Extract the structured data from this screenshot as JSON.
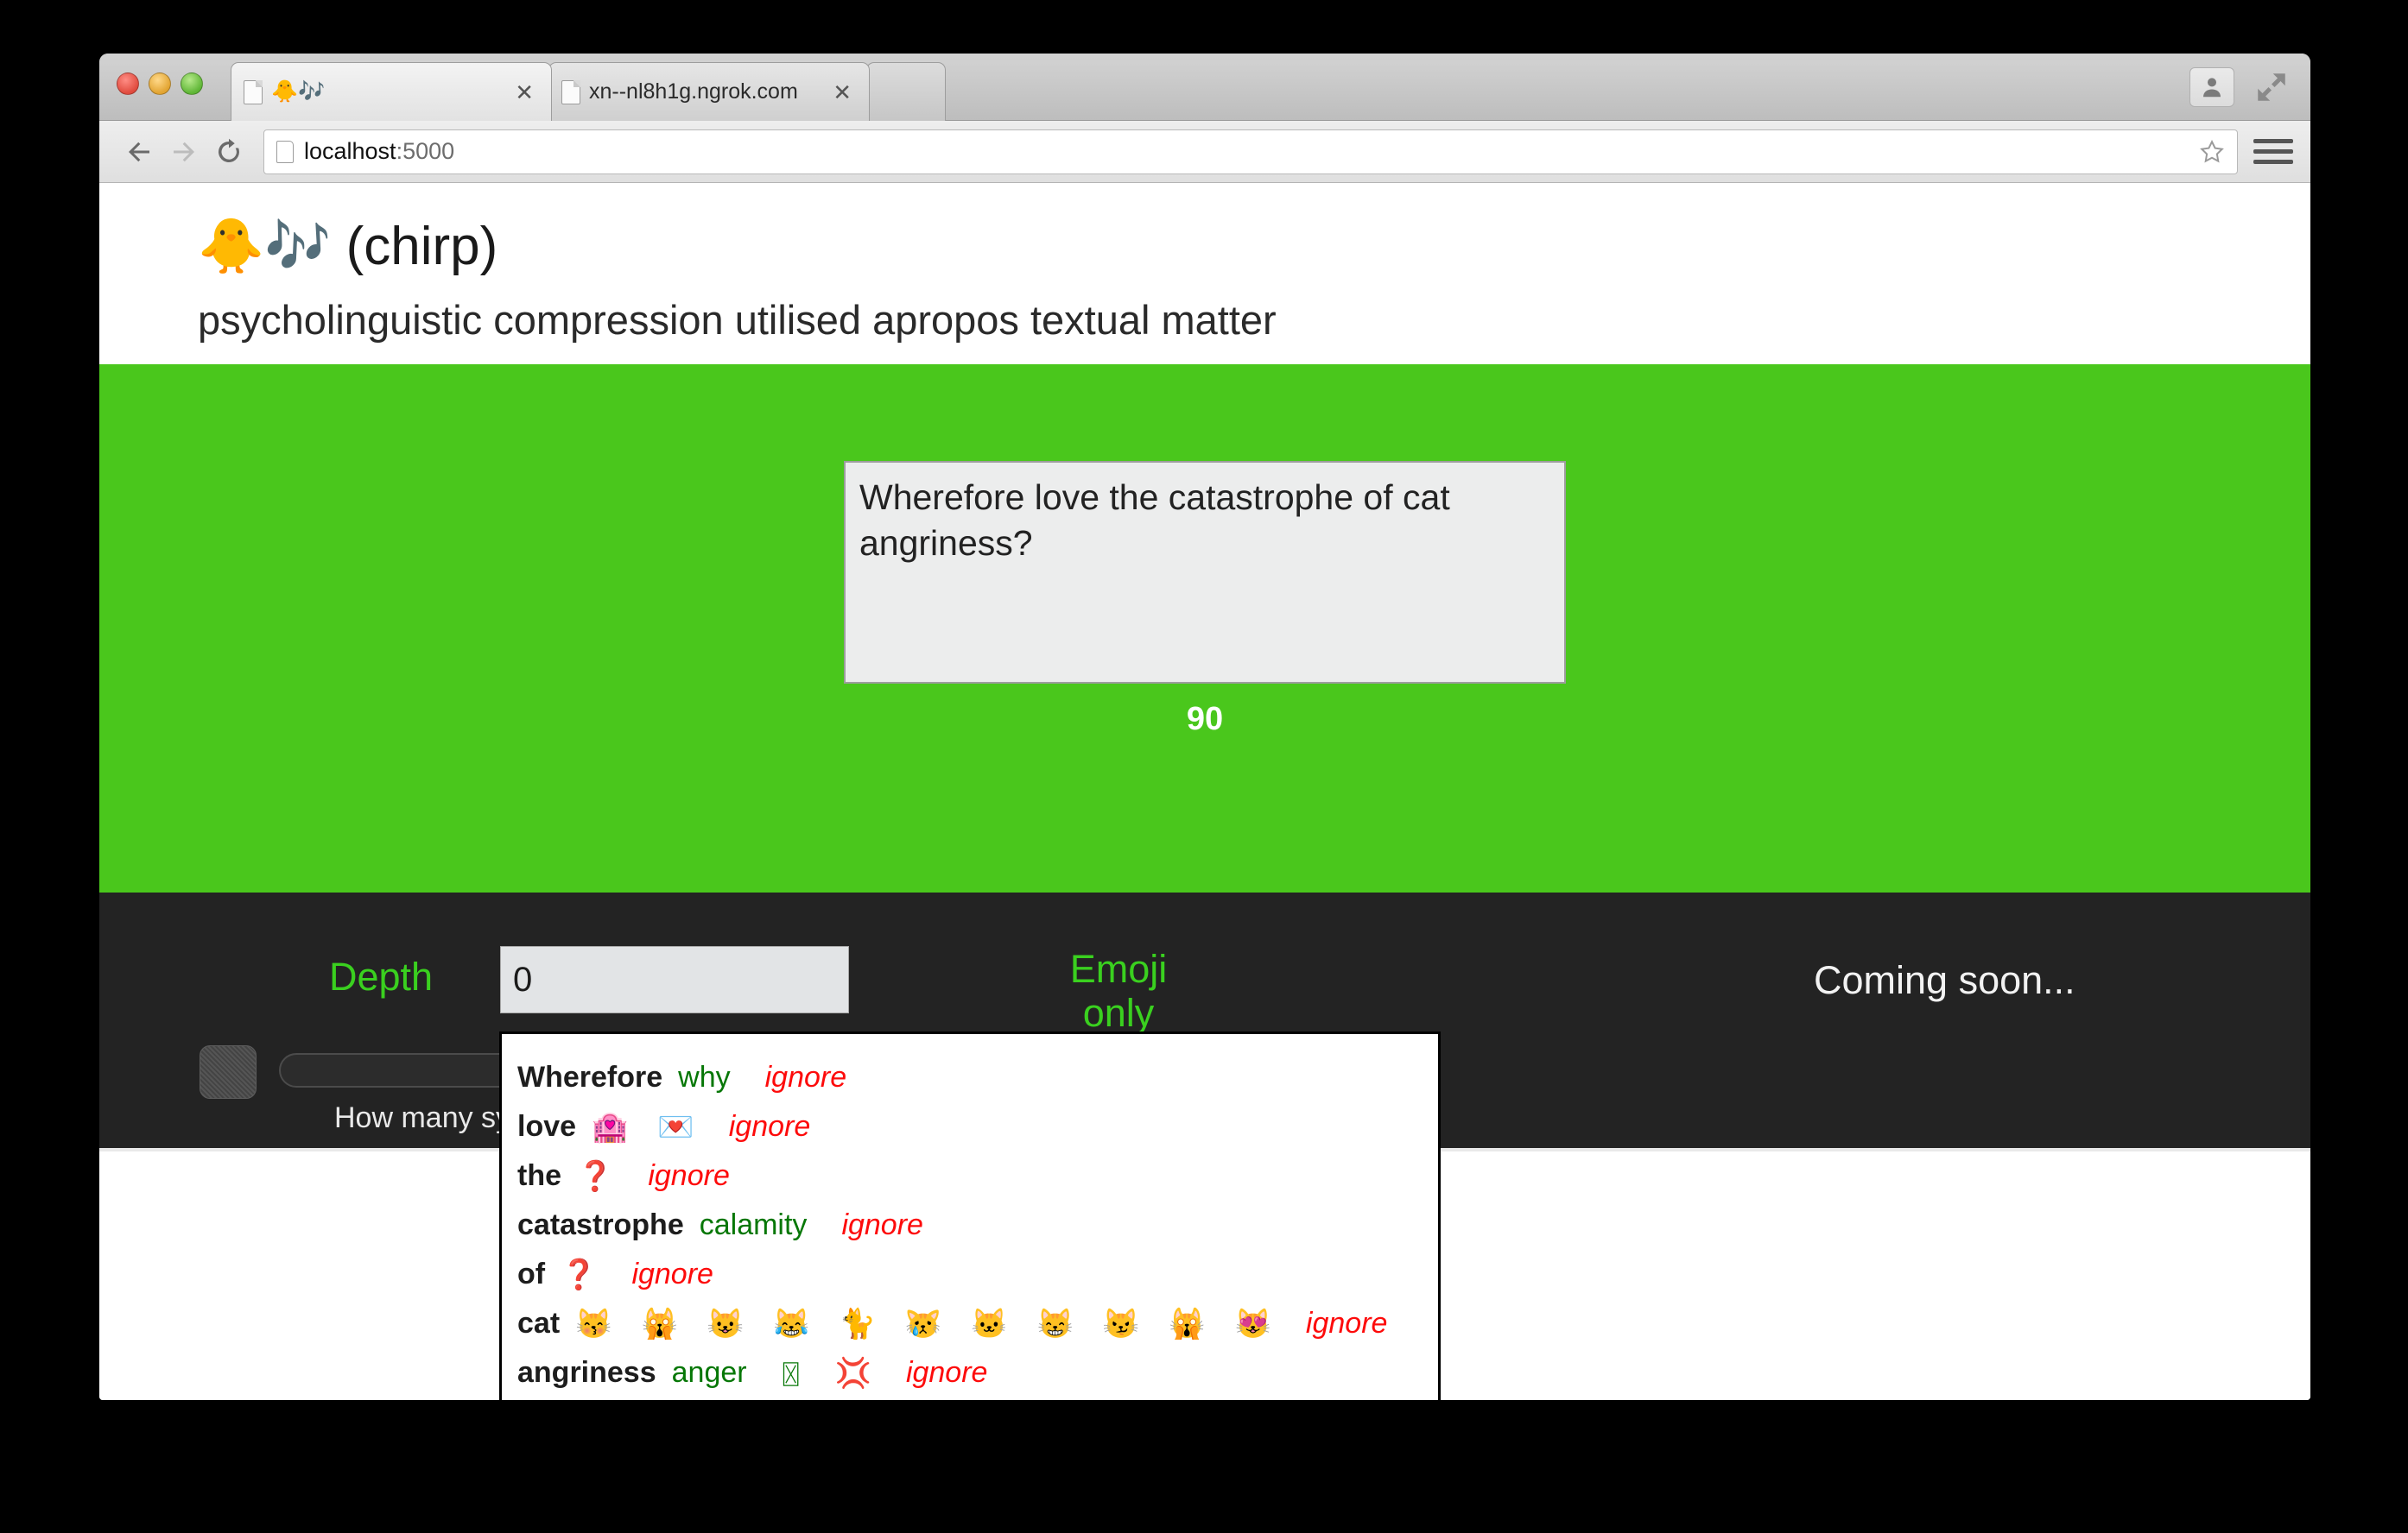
{
  "browser": {
    "traffic_lights": [
      "close",
      "minimize",
      "zoom"
    ],
    "tabs": [
      {
        "title": "🐥🎶",
        "active": true,
        "close_label": "✕"
      },
      {
        "title": "xn--nl8h1g.ngrok.com",
        "active": false,
        "close_label": "✕"
      },
      {
        "title": "",
        "active": false,
        "close_label": ""
      }
    ],
    "toolbar": {
      "back_label": "←",
      "forward_label": "→",
      "reload_label": "⟳",
      "url_host": "localhost",
      "url_port": ":5000",
      "url_full": "localhost:5000",
      "bookmark_label": "☆",
      "menu_label": "menu",
      "person_label": "profile",
      "fullscreen_label": "fullscreen"
    }
  },
  "page": {
    "title": "🐥🎶 (chirp)",
    "subtitle": "psycholinguistic compression utilised apropos textual matter",
    "accent_green": "#4ac71c",
    "dark_bar": "#232323"
  },
  "compose": {
    "text": "Wherefore love the catastrophe of cat angriness?",
    "placeholder": "",
    "char_count": "90"
  },
  "suggestions": {
    "rows": [
      {
        "word": "Wherefore",
        "synonyms": [
          "why"
        ],
        "emoji": [],
        "ignore_label": "ignore"
      },
      {
        "word": "love",
        "synonyms": [],
        "emoji": [
          "🏩",
          "💌"
        ],
        "ignore_label": "ignore"
      },
      {
        "word": "the",
        "synonyms": [],
        "emoji": [
          "❓"
        ],
        "ignore_label": "ignore"
      },
      {
        "word": "catastrophe",
        "synonyms": [
          "calamity"
        ],
        "emoji": [],
        "ignore_label": "ignore"
      },
      {
        "word": "of",
        "synonyms": [],
        "emoji": [
          "❓"
        ],
        "ignore_label": "ignore"
      },
      {
        "word": "cat",
        "synonyms": [],
        "emoji": [
          "😽",
          "🙀",
          "😺",
          "😹",
          "🐈",
          "😿",
          "🐱",
          "😸",
          "😼",
          "🙀",
          "😻"
        ],
        "ignore_label": "ignore"
      },
      {
        "word": "angriness",
        "synonyms": [
          "anger",
          "〿"
        ],
        "emoji": [
          "💢"
        ],
        "ignore_label": "ignore"
      }
    ],
    "synonym_color": "#067706",
    "ignore_color": "#fd0b0b"
  },
  "options": {
    "depth": {
      "label": "Depth",
      "value": "0",
      "slider_value": "0",
      "slider_min": "0",
      "slider_max": "10",
      "help": "How many synonyms-of-synonyms to retrieve."
    },
    "emoji_only": {
      "label_line1": "Emoji",
      "label_line2": "only",
      "state": "off"
    },
    "coming_soon": {
      "label": "Coming soon..."
    }
  }
}
